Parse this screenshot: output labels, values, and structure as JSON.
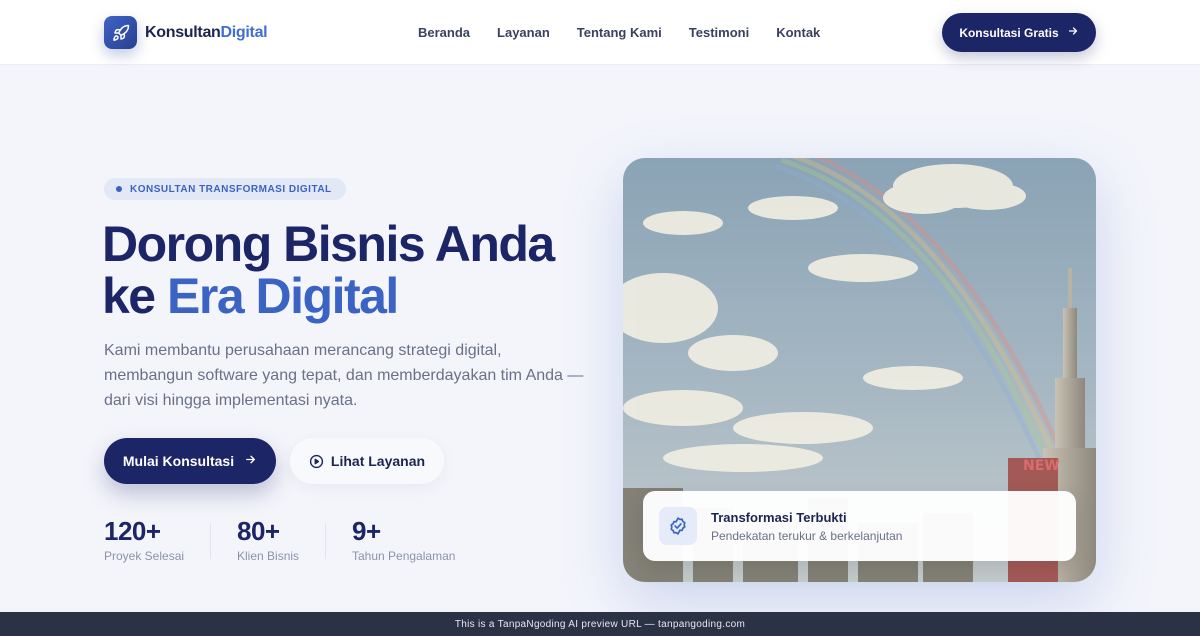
{
  "brand": {
    "name_part1": "Konsultan",
    "name_part2": "Digital",
    "logo_icon": "rocket-icon"
  },
  "nav": {
    "links": [
      "Beranda",
      "Layanan",
      "Tentang Kami",
      "Testimoni",
      "Kontak"
    ],
    "cta_label": "Konsultasi Gratis"
  },
  "hero": {
    "badge": "KONSULTAN TRANSFORMASI DIGITAL",
    "headline_line1": "Dorong Bisnis Anda",
    "headline_line2_prefix": "ke",
    "headline_line2_accent": "Era Digital",
    "subtext": "Kami membantu perusahaan merancang strategi digital, membangun software yang tepat, dan memberdayakan tim Anda — dari visi hingga implementasi nyata.",
    "primary_button": "Mulai Konsultasi",
    "secondary_button": "Lihat Layanan",
    "stats": [
      {
        "value": "120+",
        "label": "Proyek Selesai"
      },
      {
        "value": "80+",
        "label": "Klien Bisnis"
      },
      {
        "value": "9+",
        "label": "Tahun Pengalaman"
      }
    ]
  },
  "info_card": {
    "title": "Transformasi Terbukti",
    "subtitle": "Pendekatan terukur & berkelanjutan",
    "icon": "verified-badge-icon"
  },
  "footer_bar": {
    "text": "This is a TanpaNgoding AI preview URL — tanpangoding.com"
  },
  "colors": {
    "primary": "#1c2566",
    "accent": "#3b63c4",
    "background": "#f4f5fb",
    "footer": "#2c3245"
  }
}
